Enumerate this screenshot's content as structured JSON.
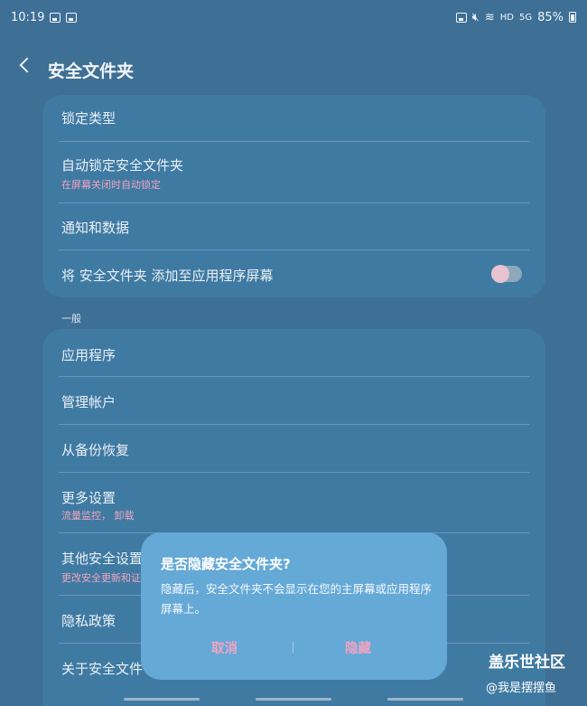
{
  "status_bar": {
    "time": "10:19",
    "indicators": "HD",
    "network": "5G",
    "battery": "85%"
  },
  "header": {
    "title": "安全文件夹"
  },
  "card1": {
    "items": [
      {
        "title": "锁定类型"
      },
      {
        "title": "自动锁定安全文件夹",
        "subtitle": "在屏幕关闭时自动锁定"
      },
      {
        "title": "通知和数据"
      },
      {
        "title": "将 安全文件夹 添加至应用程序屏幕",
        "toggle": false
      }
    ]
  },
  "section_general": "一般",
  "card2": {
    "items": [
      {
        "title": "应用程序"
      },
      {
        "title": "管理帐户"
      },
      {
        "title": "从备份恢复"
      },
      {
        "title": "更多设置",
        "subtitle": "流量监控， 卸载"
      },
      {
        "title": "其他安全设置",
        "subtitle": "更改安全更新和证"
      },
      {
        "title": "隐私政策"
      },
      {
        "title": "关于安全文件"
      }
    ]
  },
  "dialog": {
    "title": "是否隐藏安全文件夹?",
    "body": "隐藏后，安全文件夹不会显示在您的主屏幕或应用程序屏幕上。",
    "cancel": "取消",
    "confirm": "隐藏"
  },
  "watermark": {
    "title": "盖乐世社区",
    "sub": "@我是摆摆鱼"
  },
  "colors": {
    "background": "#3e6f95",
    "card": "#3f7aa2",
    "dialog": "#65a9d7",
    "accent": "#f2a3c3"
  }
}
